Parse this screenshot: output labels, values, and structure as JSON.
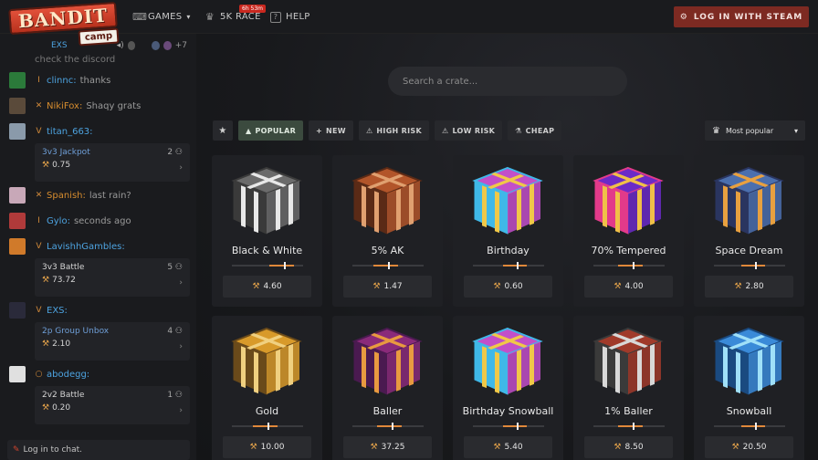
{
  "brand": {
    "main": "BANDIT",
    "sub": "camp"
  },
  "nav": {
    "games_label": "GAMES",
    "race_label": "5K RACE",
    "race_badge": "6h 53m",
    "help_label": "HELP",
    "login_label": "LOG IN WITH STEAM"
  },
  "chat": {
    "top_user": "EXS",
    "top_extra": "+7",
    "top_message": "check the discord",
    "input_label": "Log in to chat.",
    "messages": [
      {
        "user": "clinnc",
        "text": "thanks",
        "color": "#4da3e0"
      },
      {
        "user": "NikiFox",
        "text": "Shaqy grats",
        "color": "#d68c2e"
      },
      {
        "user": "titan_663",
        "text": "",
        "color": "#4da3e0",
        "game": {
          "name": "3v3 Jackpot",
          "count": "2",
          "value": "0.75"
        }
      },
      {
        "user": "Spanish",
        "text": "last rain?",
        "color": "#d68c2e"
      },
      {
        "user": "Gylo",
        "text": "seconds ago",
        "color": "#4da3e0"
      },
      {
        "user": "LavishhGambles",
        "text": "",
        "color": "#4da3e0",
        "game": {
          "name": "3v3 Battle",
          "count": "5",
          "value": "73.72"
        }
      },
      {
        "user": "EXS",
        "text": "",
        "color": "#4da3e0",
        "game": {
          "name": "2p Group Unbox",
          "count": "4",
          "value": "2.10"
        }
      },
      {
        "user": "abodegg",
        "text": "",
        "color": "#4da3e0",
        "game": {
          "name": "2v2 Battle",
          "count": "1",
          "value": "0.20"
        }
      }
    ]
  },
  "search": {
    "placeholder": "Search a crate..."
  },
  "filters": [
    {
      "label": "POPULAR",
      "active": true
    },
    {
      "label": "NEW",
      "active": false
    },
    {
      "label": "HIGH RISK",
      "active": false
    },
    {
      "label": "LOW RISK",
      "active": false
    },
    {
      "label": "CHEAP",
      "active": false
    }
  ],
  "sort": {
    "label": "Most popular"
  },
  "crates": [
    {
      "name": "Black & White",
      "price": "4.60",
      "risk": 0.73,
      "colors": [
        "#6b6b6b",
        "#e8e8e8",
        "#3a3a3a"
      ]
    },
    {
      "name": "5% AK",
      "price": "1.47",
      "risk": 0.5,
      "colors": [
        "#b2552a",
        "#e0a070",
        "#5a2a16"
      ]
    },
    {
      "name": "Birthday",
      "price": "0.60",
      "risk": 0.62,
      "colors": [
        "#c24fc9",
        "#f0c848",
        "#3fb8e8"
      ]
    },
    {
      "name": "70% Tempered",
      "price": "4.00",
      "risk": 0.55,
      "colors": [
        "#6b2ac7",
        "#f0c048",
        "#e23a8a"
      ]
    },
    {
      "name": "Space Dream",
      "price": "2.80",
      "risk": 0.58,
      "colors": [
        "#4b6fae",
        "#e8a040",
        "#2a3560"
      ]
    },
    {
      "name": "Gold",
      "price": "10.00",
      "risk": 0.5,
      "colors": [
        "#d89a2a",
        "#f0d080",
        "#6a4a1a"
      ]
    },
    {
      "name": "Baller",
      "price": "37.25",
      "risk": 0.55,
      "colors": [
        "#8a2a7a",
        "#e89a40",
        "#4a1a50"
      ]
    },
    {
      "name": "Birthday Snowball",
      "price": "5.40",
      "risk": 0.62,
      "colors": [
        "#c24fc9",
        "#f0c848",
        "#3fb8e8"
      ]
    },
    {
      "name": "1% Baller",
      "price": "8.50",
      "risk": 0.55,
      "colors": [
        "#a03a2a",
        "#d8d8d8",
        "#3a3a3a"
      ]
    },
    {
      "name": "Snowball",
      "price": "20.50",
      "risk": 0.58,
      "colors": [
        "#3a8ad8",
        "#a0e0f8",
        "#1a4a80"
      ]
    }
  ]
}
